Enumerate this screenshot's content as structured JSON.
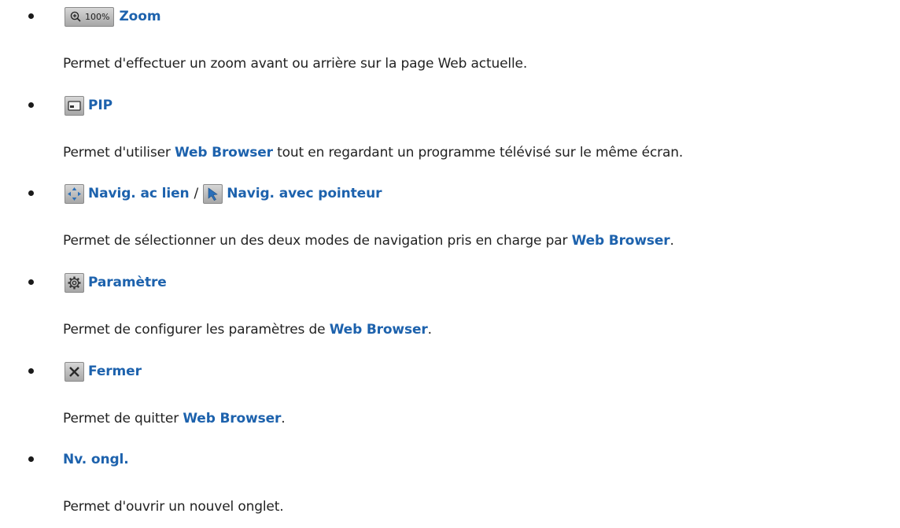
{
  "items": [
    {
      "title": "Zoom",
      "zoom_level": "100%",
      "desc": [
        {
          "text": "Permet d'effectuer un zoom avant ou arrière sur la page Web actuelle.",
          "kw": false
        }
      ]
    },
    {
      "title": "PIP",
      "desc": [
        {
          "text": "Permet d'utiliser ",
          "kw": false
        },
        {
          "text": "Web Browser",
          "kw": true
        },
        {
          "text": " tout en regardant un programme télévisé sur le même écran.",
          "kw": false
        }
      ]
    },
    {
      "title": "Navig. ac lien",
      "separator": "/",
      "title2": "Navig. avec pointeur",
      "desc": [
        {
          "text": "Permet de sélectionner un des deux modes de navigation pris en charge par ",
          "kw": false
        },
        {
          "text": "Web Browser",
          "kw": true
        },
        {
          "text": ".",
          "kw": false
        }
      ]
    },
    {
      "title": "Paramètre",
      "desc": [
        {
          "text": "Permet de configurer les paramètres de ",
          "kw": false
        },
        {
          "text": "Web Browser",
          "kw": true
        },
        {
          "text": ".",
          "kw": false
        }
      ]
    },
    {
      "title": "Fermer",
      "desc": [
        {
          "text": "Permet de quitter ",
          "kw": false
        },
        {
          "text": "Web Browser",
          "kw": true
        },
        {
          "text": ".",
          "kw": false
        }
      ]
    },
    {
      "title": "Nv. ongl.",
      "desc": [
        {
          "text": "Permet d'ouvrir un nouvel onglet.",
          "kw": false
        }
      ]
    }
  ],
  "icons": {
    "zoom": "zoom-in-icon",
    "pip": "pip-icon",
    "link_nav": "link-navigation-icon",
    "pointer_nav": "pointer-icon",
    "settings": "gear-icon",
    "close": "close-icon"
  },
  "colors": {
    "accent": "#1d62ad",
    "text": "#222222"
  }
}
